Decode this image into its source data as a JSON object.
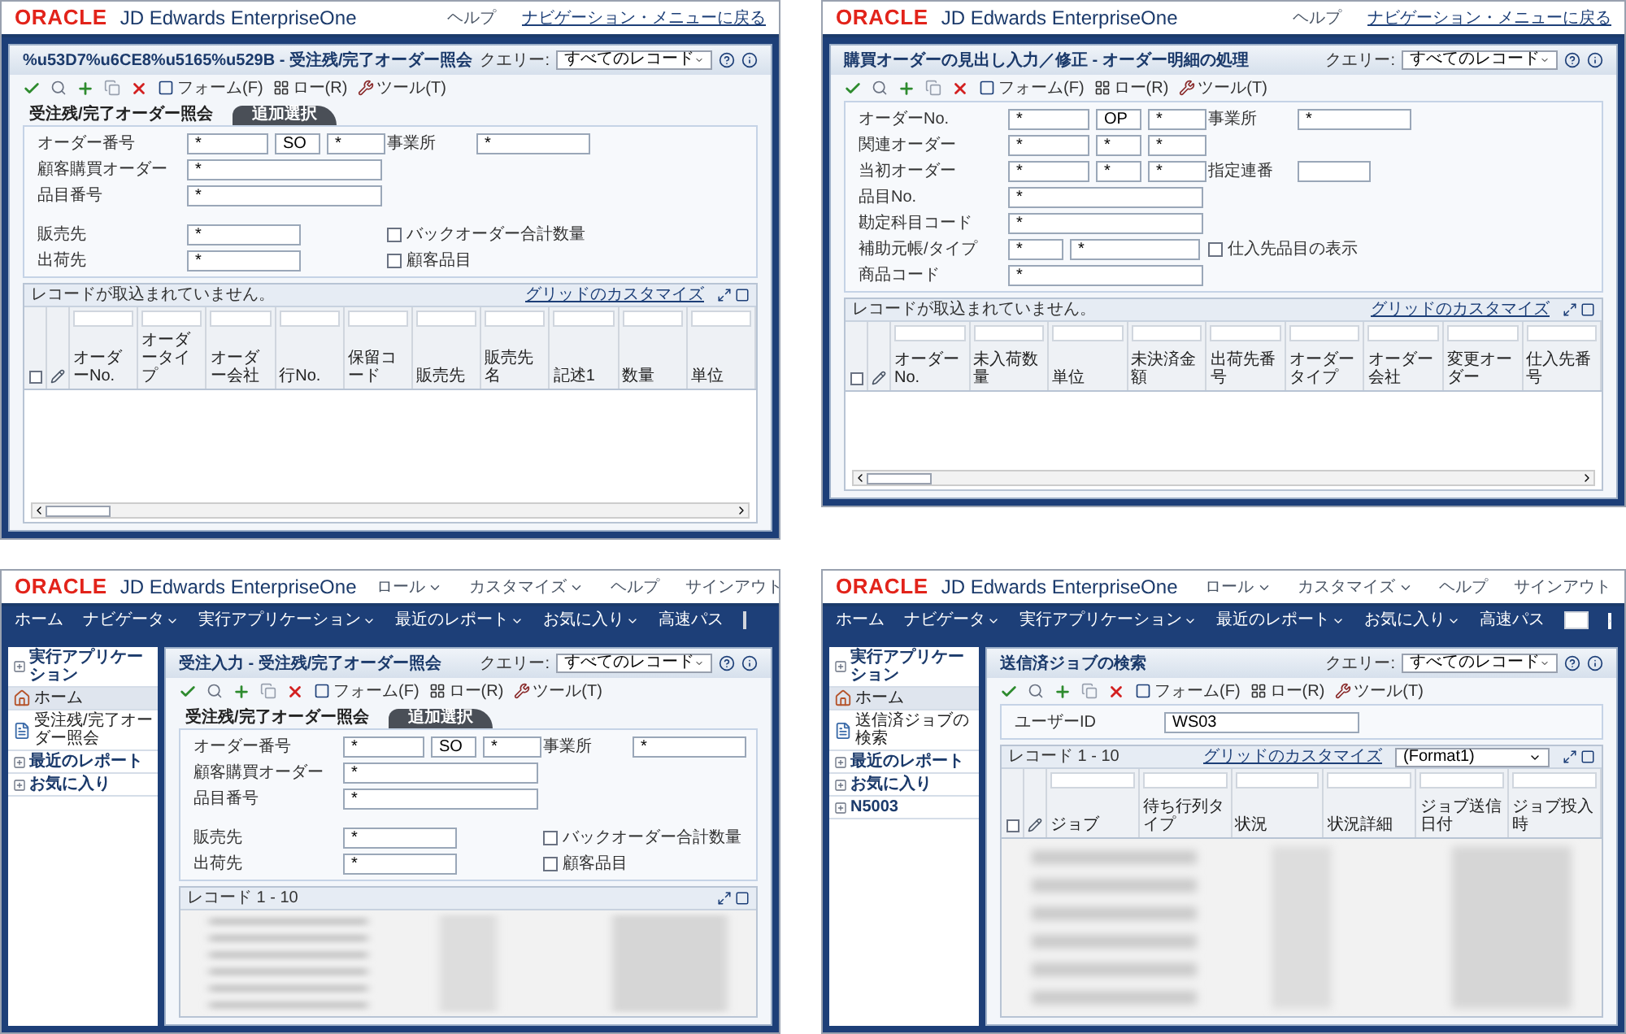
{
  "panels": [
    {
      "header": {
        "logo": "ORACLE",
        "product": "JD Edwards EnterpriseOne",
        "links": [
          {
            "label": "ヘルプ",
            "kind": "text"
          },
          {
            "label": "ナビゲーション・メニューに戻る",
            "kind": "link"
          }
        ]
      },
      "form": {
        "title": "%u53D7%u6CE8%u5165%u529B - 受注残/完了オーダー照会",
        "query_label": "クエリー:",
        "query_value": "すべてのレコード",
        "toolbar": [
          {
            "kind": "form",
            "label": "フォーム(F)"
          },
          {
            "kind": "row",
            "label": "ロー(R)"
          },
          {
            "kind": "tools",
            "label": "ツール(T)"
          }
        ],
        "tabs": [
          {
            "label": "受注残/完了オーダー照会",
            "selected": true
          },
          {
            "label": "追加選択",
            "selected": false
          }
        ],
        "groups": [
          {
            "rows": [
              {
                "label": "オーダー番号",
                "fields": [
                  "*",
                  "SO",
                  "*"
                ],
                "right": {
                  "label": "事業所",
                  "value": "*"
                }
              },
              {
                "label": "顧客購買オーダー",
                "fields": [
                  "*"
                ]
              },
              {
                "label": "品目番号",
                "fields": [
                  "*"
                ]
              }
            ]
          },
          {
            "rows": [
              {
                "label": "販売先",
                "fields": [
                  "*"
                ],
                "checkbox": {
                  "label": "バックオーダー合計数量",
                  "checked": false
                }
              },
              {
                "label": "出荷先",
                "fields": [
                  "*"
                ],
                "checkbox": {
                  "label": "顧客品目",
                  "checked": false
                }
              }
            ]
          }
        ],
        "grid": {
          "status": "レコードが取込まれていません。",
          "customize": "グリッドのカスタマイズ",
          "select_all": {
            "checked": false
          },
          "columns": [
            "オーダーNo.",
            "オーダータイプ",
            "オーダー会社",
            "行No.",
            "保留コード",
            "販売先",
            "販売先名",
            "記述1",
            "数量",
            "単位"
          ],
          "body": {
            "kind": "empty"
          }
        }
      }
    },
    {
      "header": {
        "logo": "ORACLE",
        "product": "JD Edwards EnterpriseOne",
        "links": [
          {
            "label": "ヘルプ",
            "kind": "text"
          },
          {
            "label": "ナビゲーション・メニューに戻る",
            "kind": "link"
          }
        ]
      },
      "form": {
        "title": "購買オーダーの見出し入力／修正 - オーダー明細の処理",
        "query_label": "クエリー:",
        "query_value": "すべてのレコード",
        "toolbar": [
          {
            "kind": "form",
            "label": "フォーム(F)"
          },
          {
            "kind": "row",
            "label": "ロー(R)"
          },
          {
            "kind": "tools",
            "label": "ツール(T)"
          }
        ],
        "groups": [
          {
            "rows": [
              {
                "label": "オーダーNo.",
                "fields": [
                  "*",
                  "OP",
                  "*"
                ],
                "right": {
                  "label": "事業所",
                  "value": "*"
                }
              },
              {
                "label": "関連オーダー",
                "fields": [
                  "*",
                  "*",
                  "*"
                ]
              },
              {
                "label": "当初オーダー",
                "fields": [
                  "*",
                  "*",
                  "*"
                ],
                "right": {
                  "label": "指定連番"
                }
              },
              {
                "label": "品目No.",
                "fields": [
                  "*"
                ]
              },
              {
                "label": "勘定科目コード",
                "fields": [
                  "*"
                ]
              },
              {
                "label": "補助元帳/タイプ",
                "fields": [
                  "*",
                  "*"
                ],
                "checkbox": {
                  "label": "仕入先品目の表示",
                  "checked": false
                }
              },
              {
                "label": "商品コード",
                "fields": [
                  "*"
                ]
              }
            ]
          }
        ],
        "grid": {
          "status": "レコードが取込まれていません。",
          "customize": "グリッドのカスタマイズ",
          "select_all": {
            "checked": false
          },
          "columns": [
            "オーダーNo.",
            "未入荷数量",
            "単位",
            "未決済金額",
            "出荷先番号",
            "オーダータイプ",
            "オーダー会社",
            "変更オーダー",
            "仕入先番号"
          ],
          "body": {
            "kind": "empty"
          }
        }
      }
    },
    {
      "header": {
        "logo": "ORACLE",
        "product": "JD Edwards EnterpriseOne",
        "links": [
          {
            "label": "ロール",
            "kind": "menu"
          },
          {
            "label": "カスタマイズ",
            "kind": "menu"
          },
          {
            "label": "ヘルプ",
            "kind": "text"
          },
          {
            "label": "サインアウト",
            "kind": "text"
          }
        ]
      },
      "nav": {
        "items": [
          {
            "label": "ホーム",
            "menu": false
          },
          {
            "label": "ナビゲータ",
            "menu": true
          },
          {
            "label": "実行アプリケーション",
            "menu": true
          },
          {
            "label": "最近のレポート",
            "menu": true
          },
          {
            "label": "お気に入り",
            "menu": true
          }
        ],
        "search_label": "高速パス"
      },
      "sidebar": [
        {
          "label": "実行アプリケーション",
          "kind": "section",
          "selected": false
        },
        {
          "label": "ホーム",
          "kind": "home",
          "selected": true
        },
        {
          "label": "受注残/完了オーダー照会",
          "kind": "app",
          "selected": false
        },
        {
          "label": "最近のレポート",
          "kind": "section",
          "selected": false
        },
        {
          "label": "お気に入り",
          "kind": "section",
          "selected": false
        }
      ],
      "form": {
        "title": "受注入力 - 受注残/完了オーダー照会",
        "query_label": "クエリー:",
        "query_value": "すべてのレコード",
        "toolbar": [
          {
            "kind": "form",
            "label": "フォーム(F)"
          },
          {
            "kind": "row",
            "label": "ロー(R)"
          },
          {
            "kind": "tools",
            "label": "ツール(T)"
          }
        ],
        "tabs": [
          {
            "label": "受注残/完了オーダー照会",
            "selected": true
          },
          {
            "label": "追加選択",
            "selected": false
          }
        ],
        "groups": [
          {
            "rows": [
              {
                "label": "オーダー番号",
                "fields": [
                  "*",
                  "SO",
                  "*"
                ],
                "right": {
                  "label": "事業所",
                  "value": "*"
                }
              },
              {
                "label": "顧客購買オーダー",
                "fields": [
                  "*"
                ]
              },
              {
                "label": "品目番号",
                "fields": [
                  "*"
                ]
              }
            ]
          },
          {
            "rows": [
              {
                "label": "販売先",
                "fields": [
                  "*"
                ],
                "checkbox": {
                  "label": "バックオーダー合計数量",
                  "checked": false
                }
              },
              {
                "label": "出荷先",
                "fields": [
                  "*"
                ],
                "checkbox": {
                  "label": "顧客品目",
                  "checked": false
                }
              }
            ]
          }
        ],
        "grid": {
          "status": "レコード 1 - 10",
          "body": {
            "kind": "picture"
          }
        }
      }
    },
    {
      "header": {
        "logo": "ORACLE",
        "product": "JD Edwards EnterpriseOne",
        "links": [
          {
            "label": "ロール",
            "kind": "menu"
          },
          {
            "label": "カスタマイズ",
            "kind": "menu"
          },
          {
            "label": "ヘルプ",
            "kind": "text"
          },
          {
            "label": "サインアウト",
            "kind": "text"
          }
        ]
      },
      "nav": {
        "items": [
          {
            "label": "ホーム",
            "menu": false
          },
          {
            "label": "ナビゲータ",
            "menu": true
          },
          {
            "label": "実行アプリケーション",
            "menu": true
          },
          {
            "label": "最近のレポート",
            "menu": true
          },
          {
            "label": "お気に入り",
            "menu": true
          }
        ],
        "search_label": "高速パス"
      },
      "sidebar": [
        {
          "label": "実行アプリケーション",
          "kind": "section",
          "selected": false
        },
        {
          "label": "ホーム",
          "kind": "home",
          "selected": true
        },
        {
          "label": "送信済ジョブの検索",
          "kind": "app",
          "selected": false
        },
        {
          "label": "最近のレポート",
          "kind": "section",
          "selected": false
        },
        {
          "label": "お気に入り",
          "kind": "section",
          "selected": false
        },
        {
          "label": "N5003",
          "kind": "section",
          "selected": false
        }
      ],
      "form": {
        "title": "送信済ジョブの検索",
        "query_label": "クエリー:",
        "query_value": "すべてのレコード",
        "toolbar": [
          {
            "kind": "form",
            "label": "フォーム(F)"
          },
          {
            "kind": "row",
            "label": "ロー(R)"
          },
          {
            "kind": "tools",
            "label": "ツール(T)"
          }
        ],
        "groups": [
          {
            "rows": [
              {
                "label": "ユーザーID",
                "fields": [
                  "WS03"
                ]
              }
            ]
          }
        ],
        "grid": {
          "status": "レコード 1 - 10",
          "customize": "グリッドのカスタマイズ",
          "format": "(Format1)",
          "select_all": {
            "checked": false
          },
          "columns": [
            "ジョブ",
            "待ち行列タイプ",
            "状況",
            "状況詳細",
            "ジョブ送信日付",
            "ジョブ投入時"
          ],
          "body": {
            "kind": "picture"
          }
        }
      }
    }
  ]
}
